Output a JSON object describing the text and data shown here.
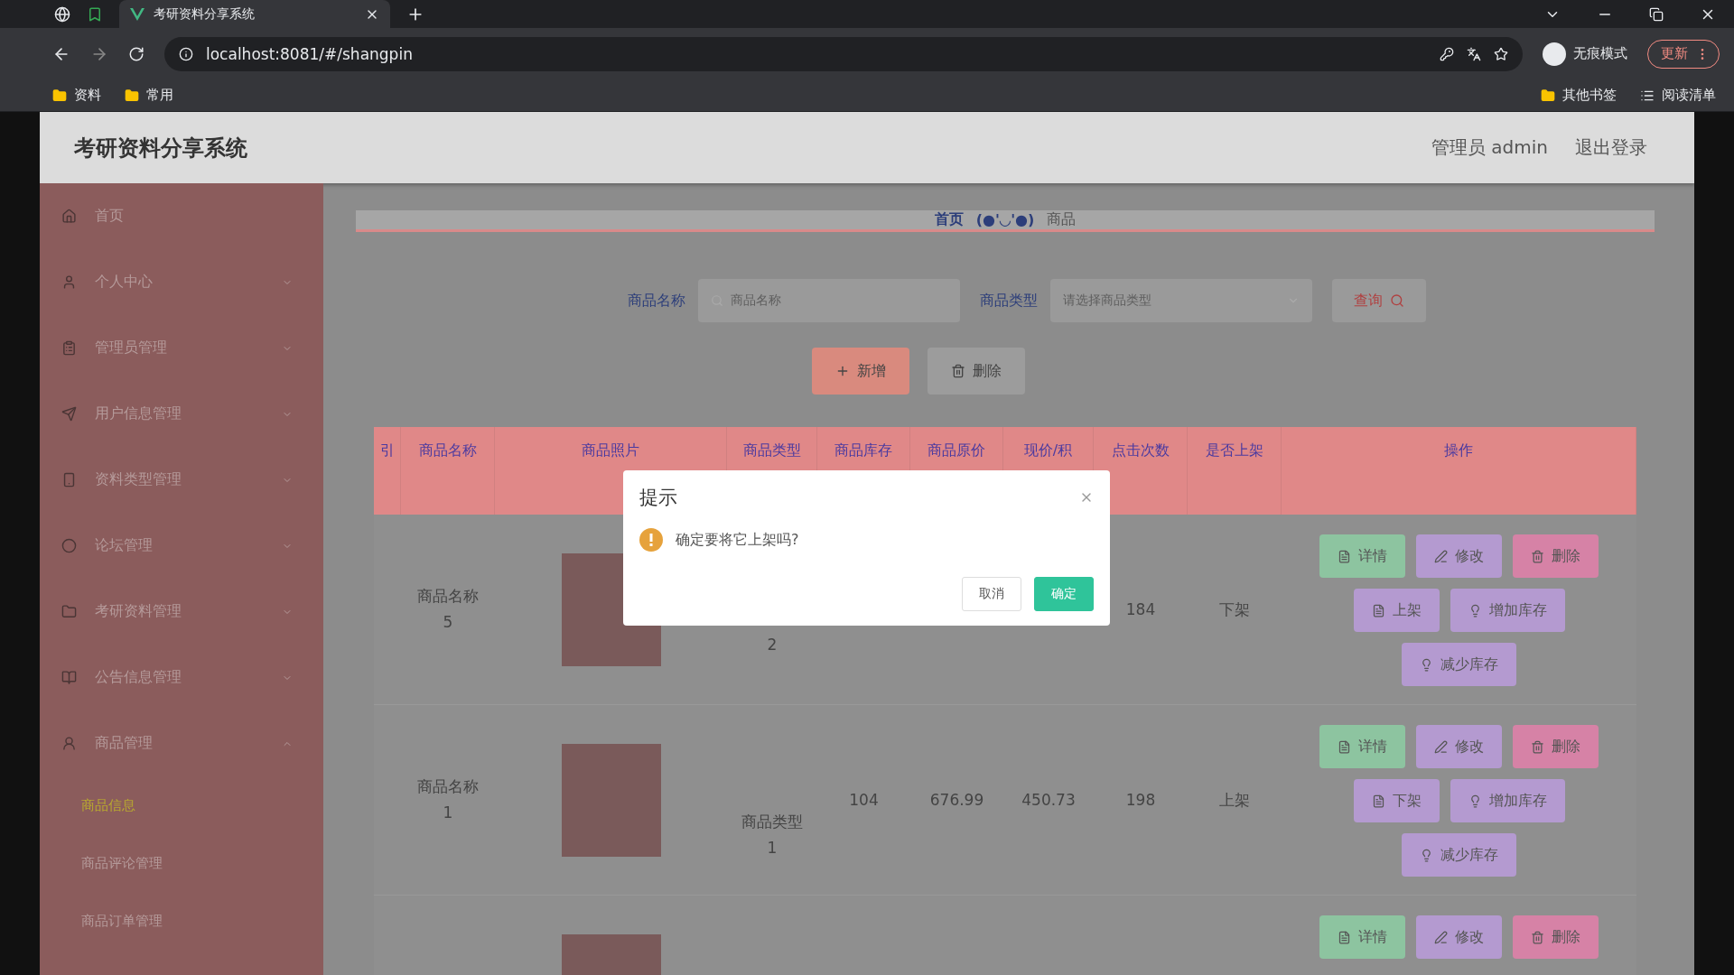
{
  "browser": {
    "tab_title": "考研资料分享系统",
    "url": "localhost:8081/#/shangpin",
    "profile": "无痕模式",
    "update_button": "更新",
    "bookmarks": [
      "资料",
      "常用"
    ],
    "bookmarks_right": [
      {
        "label": "其他书签",
        "kind": "folder"
      },
      {
        "label": "阅读清单",
        "kind": "list"
      }
    ]
  },
  "header": {
    "title": "考研资料分享系统",
    "user": "管理员 admin",
    "logout": "退出登录"
  },
  "sidebar": {
    "items": [
      {
        "label": "首页"
      },
      {
        "label": "个人中心",
        "expanded": false
      },
      {
        "label": "管理员管理",
        "expanded": false
      },
      {
        "label": "用户信息管理",
        "expanded": false
      },
      {
        "label": "资料类型管理",
        "expanded": false
      },
      {
        "label": "论坛管理",
        "expanded": false
      },
      {
        "label": "考研资料管理",
        "expanded": false
      },
      {
        "label": "公告信息管理",
        "expanded": false
      },
      {
        "label": "商品管理",
        "expanded": true,
        "children": [
          {
            "label": "商品信息",
            "selected": true
          },
          {
            "label": "商品评论管理",
            "selected": false
          },
          {
            "label": "商品订单管理",
            "selected": false
          }
        ]
      }
    ]
  },
  "breadcrumb": [
    "首页",
    "(●'◡'●)",
    "商品"
  ],
  "search": {
    "fields": [
      {
        "label": "商品名称",
        "placeholder": "商品名称",
        "kind": "input"
      },
      {
        "label": "商品类型",
        "placeholder": "请选择商品类型",
        "kind": "select"
      }
    ],
    "button": "查询"
  },
  "actions": [
    {
      "label": "新增",
      "kind": "add"
    },
    {
      "label": "删除",
      "kind": "delete"
    }
  ],
  "table": {
    "columns": [
      "引",
      "商品名称",
      "商品照片",
      "商品类型",
      "商品库存",
      "商品原价",
      "现价/积",
      "点击次数",
      "是否上架",
      "操作"
    ],
    "rows": [
      {
        "name": "商品名称 5",
        "type": "2",
        "stock": "",
        "price": "",
        "now": "",
        "clicks": "184",
        "status": "下架",
        "buttons": [
          {
            "label": "详情",
            "kind": "detail"
          },
          {
            "label": "修改",
            "kind": "edit"
          },
          {
            "label": "删除",
            "kind": "delete"
          },
          {
            "label": "上架",
            "kind": "shelf"
          },
          {
            "label": "增加库存",
            "kind": "stock"
          },
          {
            "label": "减少库存",
            "kind": "stock"
          }
        ]
      },
      {
        "name": "商品名称 1",
        "type": "商品类型 1",
        "stock": "104",
        "price": "676.99",
        "now": "450.73",
        "clicks": "198",
        "status": "上架",
        "buttons": [
          {
            "label": "详情",
            "kind": "detail"
          },
          {
            "label": "修改",
            "kind": "edit"
          },
          {
            "label": "删除",
            "kind": "delete"
          },
          {
            "label": "下架",
            "kind": "shelf"
          },
          {
            "label": "增加库存",
            "kind": "stock"
          },
          {
            "label": "减少库存",
            "kind": "stock"
          }
        ]
      },
      {
        "name": "",
        "type": "",
        "stock": "",
        "price": "",
        "now": "",
        "clicks": "",
        "status": "",
        "buttons": [
          {
            "label": "详情",
            "kind": "detail"
          },
          {
            "label": "修改",
            "kind": "edit"
          },
          {
            "label": "删除",
            "kind": "delete"
          }
        ]
      }
    ]
  },
  "dialog": {
    "title": "提示",
    "message": "确定要将它上架吗?",
    "buttons": [
      {
        "label": "取消",
        "kind": "cancel"
      },
      {
        "label": "确定",
        "kind": "primary"
      }
    ]
  }
}
